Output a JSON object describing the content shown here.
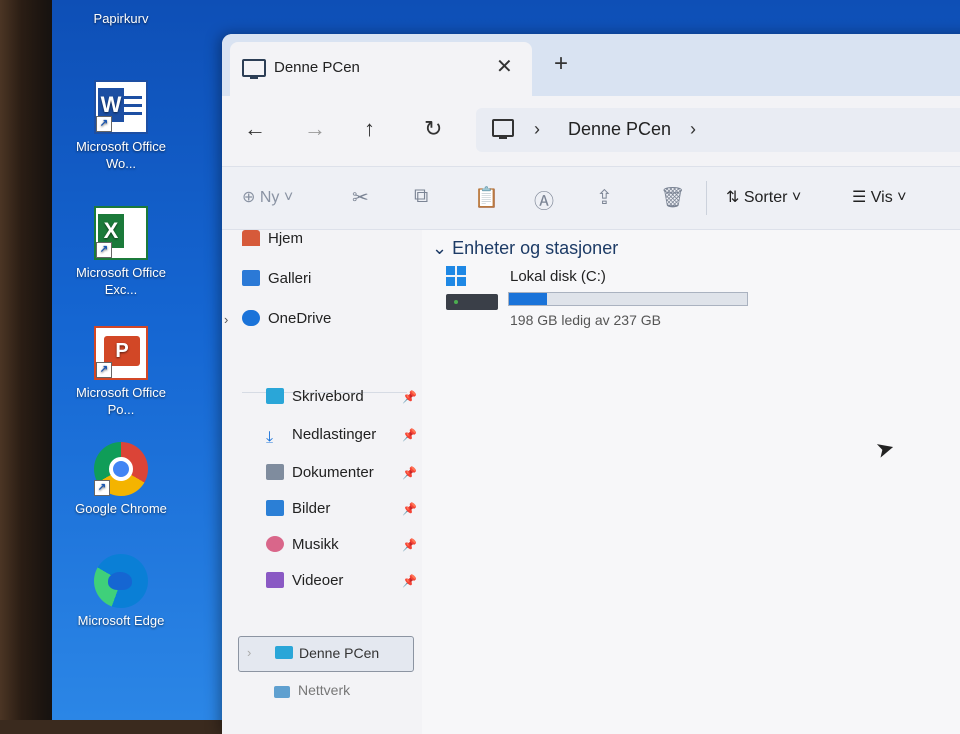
{
  "desktop": {
    "icons": [
      {
        "label": "Papirkurv"
      },
      {
        "label": "Microsoft Office Wo..."
      },
      {
        "label": "Microsoft Office Exc..."
      },
      {
        "label": "Microsoft Office Po..."
      },
      {
        "label": "Google Chrome"
      },
      {
        "label": "Microsoft Edge"
      }
    ]
  },
  "window": {
    "tab_title": "Denne PCen",
    "close_glyph": "✕",
    "newtab_glyph": "+",
    "nav": {
      "back": "←",
      "forward": "→",
      "up": "↑",
      "refresh": "↻"
    },
    "address": {
      "crumb": "Denne PCen",
      "sep": "›"
    },
    "toolbar": {
      "new_label": "Ny",
      "sort_label": "Sorter",
      "view_label": "Vis"
    },
    "sidebar": {
      "top": [
        "Hjem",
        "Galleri",
        "OneDrive"
      ],
      "pinned": [
        "Skrivebord",
        "Nedlastinger",
        "Dokumenter",
        "Bilder",
        "Musikk",
        "Videoer"
      ],
      "bottom": [
        "Denne PCen",
        "Nettverk"
      ]
    },
    "content": {
      "group_title": "Enheter og stasjoner",
      "drive": {
        "name": "Lokal disk (C:)",
        "free_text": "198 GB ledig av 237 GB",
        "used_fraction": 0.16
      }
    }
  }
}
